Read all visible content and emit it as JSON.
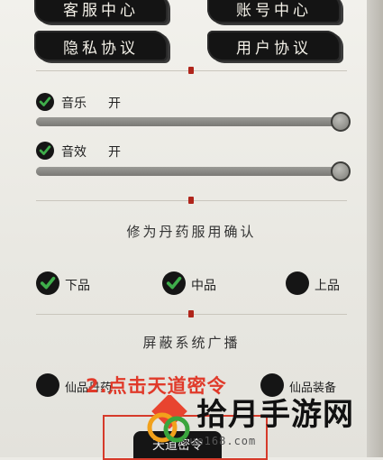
{
  "top_buttons": {
    "customer_service": "客服中心",
    "account_center": "账号中心",
    "privacy_agreement": "隐私协议",
    "user_agreement": "用户协议"
  },
  "audio": {
    "music_label": "音乐",
    "music_state": "开",
    "music_level": 1.0,
    "sfx_label": "音效",
    "sfx_state": "开",
    "sfx_level": 1.0
  },
  "pill_confirm": {
    "title": "修为丹药服用确认",
    "options": [
      {
        "label": "下品",
        "checked": true
      },
      {
        "label": "中品",
        "checked": true
      },
      {
        "label": "上品",
        "checked": false
      }
    ]
  },
  "broadcast": {
    "title": "屏蔽系统广播",
    "options": [
      {
        "label": "仙品丹药",
        "checked": false
      },
      {
        "label": "仙品装备",
        "checked": false
      }
    ]
  },
  "annotation": "2.点击天道密令",
  "bottom_button": "天道密令",
  "watermark": {
    "text": "拾月手游网",
    "url": "yue168.com"
  },
  "colors": {
    "accent_green": "#3fae4b",
    "annotation_red": "#e03a2a",
    "ink_black": "#141414"
  }
}
